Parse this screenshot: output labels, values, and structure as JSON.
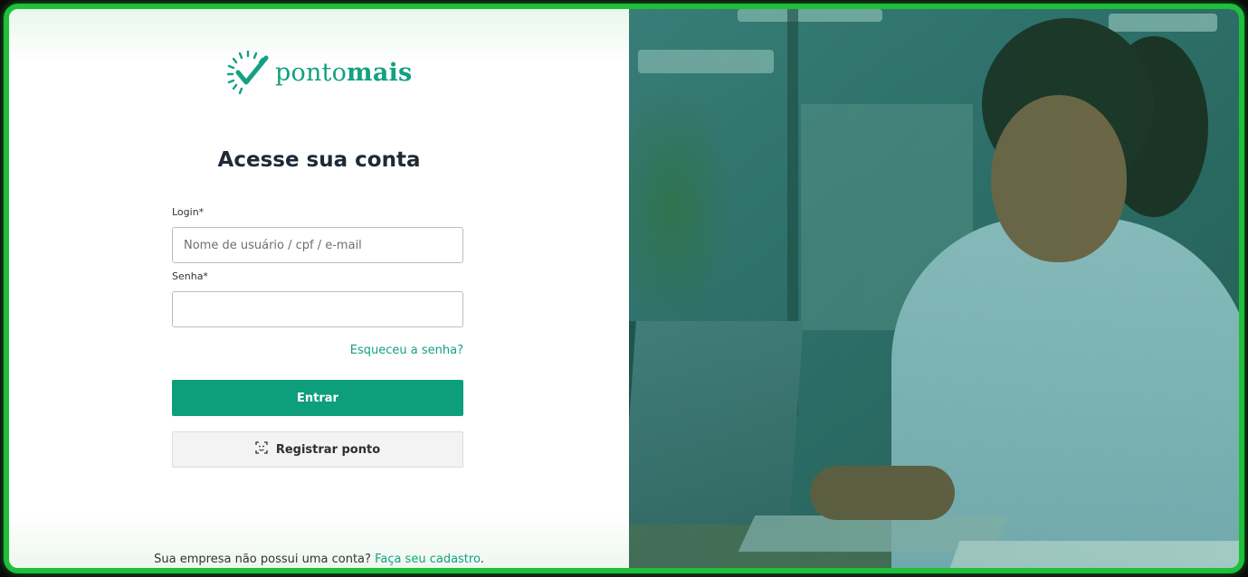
{
  "brand": {
    "name_regular": "ponto",
    "name_bold": "mais"
  },
  "login": {
    "title": "Acesse sua conta",
    "login_label": "Login*",
    "login_placeholder": "Nome de usuário / cpf / e-mail",
    "login_value": "",
    "password_label": "Senha*",
    "password_value": "",
    "forgot_link": "Esqueceu a senha?",
    "submit_label": "Entrar",
    "register_point_label": "Registrar ponto"
  },
  "footer": {
    "text": "Sua empresa não possui uma conta?",
    "signup_link": "Faça seu cadastro",
    "suffix": "."
  },
  "colors": {
    "accent": "#0d9e7b",
    "link": "#13a181",
    "frame_border": "#1fbf3a"
  },
  "icons": {
    "logo": "clock-check-icon",
    "register": "face-scan-icon"
  }
}
